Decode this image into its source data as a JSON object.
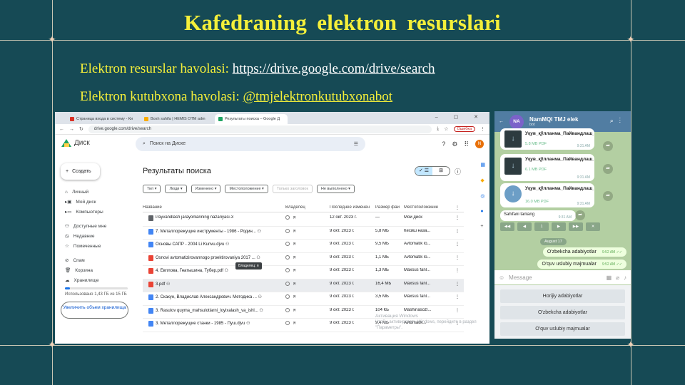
{
  "slide": {
    "title": "Kafedraning  elektron  resurslari",
    "line1_label": "Elektron resurslar havolasi: ",
    "line1_link": "https://drive.google.com/drive/search",
    "line2_label": "Elektron kutubxona havolasi: ",
    "line2_link": "@tmjelektronkutubxonabot"
  },
  "browser": {
    "tabs": [
      "Страница входа в систему - Ки",
      "Bosh sahifa | HEMIS OTM adm",
      "Результаты поиска – Google Д"
    ],
    "url": "drive.google.com/drive/search",
    "error_badge": "Ошибка",
    "app_name": "Диск",
    "search_placeholder": "Поиск на Диске",
    "avatar_letter": "N",
    "new_button": "Создать",
    "sidebar": [
      "Личный",
      "Мой диск",
      "Компьютеры",
      "Доступные мне",
      "Недавние",
      "Помеченные",
      "Спам",
      "Корзина",
      "Хранилище"
    ],
    "storage_text": "Использовано 1,43 ГБ из 15 ГБ",
    "buy_button": "Увеличить объем хранилища",
    "results_title": "Результаты поиска",
    "filters": [
      "Тип ▾",
      "Люди ▾",
      "Изменено ▾",
      "Местоположение ▾",
      "Только заголовок",
      "Не выполнено ▾"
    ],
    "columns": [
      "Название",
      "Владелец",
      "Последнее изменен",
      "Размер фай",
      "Местоположение",
      "⋮"
    ],
    "rows": [
      {
        "name": "Payvandlash jarayonlarining nazariyasi-3",
        "owner": "я",
        "date": "12 окт. 2023 г.",
        "size": "—",
        "loc": "Мой диск",
        "color": "#5f6368"
      },
      {
        "name": "7. Металлорежущие инструменты - 1986 - Родин... ⚇",
        "owner": "я",
        "date": "9 окт. 2023 г.",
        "size": "5,8 МБ",
        "loc": "Кесиш наза...",
        "color": "#4285f4"
      },
      {
        "name": "Основы САПР - 2004 Li Kunvu.djvu ⚇",
        "owner": "я",
        "date": "9 окт. 2023 г.",
        "size": "9,5 МБ",
        "loc": "Avtomatik lo...",
        "color": "#4285f4"
      },
      {
        "name": "Osnovi avtomatizirovannogo proektirovaniya 2017 ... ⚇",
        "owner": "я",
        "date": "9 окт. 2023 г.",
        "size": "1,1 МБ",
        "loc": "Avtomatik lo...",
        "color": "#ea4335"
      },
      {
        "name": "4. Евплова, Гнатышина, Тубер.pdf ⚇",
        "owner": "я",
        "date": "9 окт. 2023 г.",
        "size": "1,3 МБ",
        "loc": "Maxsus fanl...",
        "color": "#ea4335"
      },
      {
        "name": "3.pdf ⚇",
        "owner": "я",
        "date": "9 окт. 2023 г.",
        "size": "16,4 МБ",
        "loc": "Maxsus fanl...",
        "color": "#ea4335"
      },
      {
        "name": "2. Скакун, Владислав Александрович. Методика ... ⚇",
        "owner": "я",
        "date": "9 окт. 2023 г.",
        "size": "3,5 МБ",
        "loc": "Maxsus fanl...",
        "color": "#4285f4"
      },
      {
        "name": "3. Rasulov quyma_mahsulotlarni_loyixalash_va_ishl... ⚇",
        "owner": "я",
        "date": "9 окт. 2023 г.",
        "size": "104 КБ",
        "loc": "Mashinasozl...",
        "color": "#4285f4"
      },
      {
        "name": "3. Металлорежущие станки - 1985 - Пуш.djvu ⚇",
        "owner": "я",
        "date": "9 окт. 2023 г.",
        "size": "9,4 МБ",
        "loc": "Avtomatik...",
        "color": "#4285f4"
      }
    ],
    "tooltip": "Владелец: я",
    "watermark_title": "Активация Windows",
    "watermark_text": "Чтобы активировать Windows, перейдите в раздел \"Параметры\"."
  },
  "telegram": {
    "avatar": "NA",
    "name": "NamMQI TMJ elek",
    "subtitle": "bot",
    "files": [
      {
        "name": "Ўқув_қўлланма_Пайвандлаш_бир...",
        "size": "5.8 MB PDF",
        "time": "9:31 AM"
      },
      {
        "name": "Ўқув_қўлланма_Пайвандлаш_иши...",
        "size": "6.1 MB PDF",
        "time": "9:31 AM"
      },
      {
        "name": "Ўқув_қўлланма_Пайвандлаш_иши_асосла...",
        "size": "16.0 MB PDF",
        "time": "9:31 AM"
      }
    ],
    "page_prompt": "Sahifani tanlang",
    "page_time": "9:31 AM",
    "page_buttons": [
      "◀◀",
      "◀",
      "1",
      "▶",
      "▶▶",
      "✕"
    ],
    "date_chip": "August 17",
    "out_msgs": [
      {
        "text": "O'zbekcha adabiyotlar",
        "time": "9:52 AM ✓✓"
      },
      {
        "text": "O'quv uslubiy majmualar",
        "time": "9:52 AM ✓✓"
      }
    ],
    "input_placeholder": "Message",
    "keyboard": [
      "Horijiy adabiyotlar",
      "O'zbekcha adabiyotlar",
      "O'quv uslubiy majmualar"
    ]
  }
}
